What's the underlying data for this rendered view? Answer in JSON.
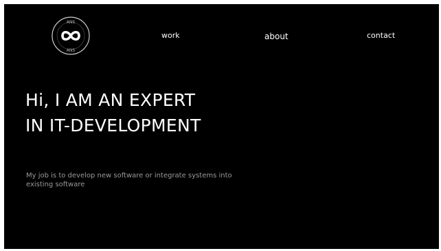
{
  "logo": {
    "top_text": "ANS",
    "bottom_text": "ANS",
    "icon": "infinity-icon"
  },
  "nav": {
    "work": "work",
    "about": "about",
    "contact": "contact"
  },
  "hero": {
    "title_line1": "Hi, I AM AN EXPERT",
    "title_line2": "IN IT-DEVELOPMENT",
    "subtitle": "My job is to develop new software or integrate systems into existing software"
  },
  "colors": {
    "background": "#000000",
    "text": "#ffffff",
    "muted_text": "#9a9a9a"
  }
}
